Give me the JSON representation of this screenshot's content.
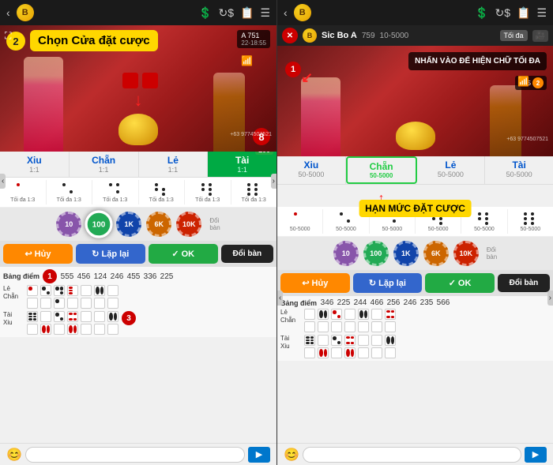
{
  "left_panel": {
    "nav": {
      "back_icon": "‹",
      "coin_label": "B",
      "dollar_icon": "$",
      "refresh_icon": "↻",
      "list_icon": "≡",
      "menu_icon": "☰"
    },
    "annotation": {
      "step2_label": "2",
      "instruction": "Chọn Cửa đặt cược",
      "step8_label": "8",
      "step1_label": "1",
      "step3_label": "3"
    },
    "bet_columns": [
      {
        "label": "Xiu",
        "ratio": "1:1",
        "active": false
      },
      {
        "label": "Chẵn",
        "ratio": "1:1",
        "active": false
      },
      {
        "label": "Lẻ",
        "ratio": "1:1",
        "active": false
      },
      {
        "label": "Tài",
        "ratio": "1:1",
        "active": true,
        "value": "100"
      }
    ],
    "chips": [
      {
        "value": "10",
        "color": "#8855aa"
      },
      {
        "value": "100",
        "color": "#22aa55",
        "selected": true
      },
      {
        "value": "1K",
        "color": "#1144aa"
      },
      {
        "value": "6K",
        "color": "#cc6600"
      },
      {
        "value": "10K",
        "color": "#cc2200"
      }
    ],
    "buttons": {
      "cancel": "Hủy",
      "replay": "Lặp lại",
      "ok": "OK",
      "change_table": "Đổi bàn"
    },
    "score_board": {
      "label": "Bảng điểm",
      "numbers": [
        "555",
        "456",
        "124",
        "246",
        "455",
        "336",
        "225"
      ],
      "rows": [
        {
          "label": "Lẻ\nChẵn"
        },
        {
          "label": "Tài\nXiu"
        }
      ]
    }
  },
  "right_panel": {
    "nav": {
      "back_icon": "‹",
      "coin_label": "B",
      "dollar_icon": "$",
      "refresh_icon": "↻",
      "list_icon": "≡",
      "menu_icon": "☰"
    },
    "game_info": {
      "close": "✕",
      "name": "Sic Bo A",
      "id": "759",
      "range": "10-5000",
      "toi_da": "Tối đa",
      "cam": "🎥"
    },
    "annotation": {
      "step1_label": "1",
      "note_title": "NHẤN VÀO ĐỂ HIỆN\nCHỮ TỐI ĐA",
      "han_muc": "HẠN MỨC ĐẶT CƯỢC"
    },
    "bet_columns": [
      {
        "label": "Xiu",
        "ratio": "50-5000",
        "active": false
      },
      {
        "label": "Chẵn",
        "ratio": "50-5000",
        "highlighted": true
      },
      {
        "label": "Lẻ",
        "ratio": "50-5000",
        "active": false
      },
      {
        "label": "Tài",
        "ratio": "50-5000",
        "active": false
      }
    ],
    "chips": [
      {
        "value": "10",
        "color": "#8855aa"
      },
      {
        "value": "100",
        "color": "#22aa55"
      },
      {
        "value": "1K",
        "color": "#1144aa"
      },
      {
        "value": "6K",
        "color": "#cc6600"
      },
      {
        "value": "10K",
        "color": "#cc2200"
      }
    ],
    "buttons": {
      "cancel": "Hủy",
      "replay": "Lặp lại",
      "ok": "OK",
      "change_table": "Đổi bàn"
    },
    "score_board": {
      "label": "Bảng điểm",
      "numbers": [
        "346",
        "225",
        "244",
        "466",
        "256",
        "246",
        "235",
        "566"
      ],
      "rows": [
        {
          "label": "Lẻ\nChẵn"
        },
        {
          "label": "Tài\nXiu"
        }
      ]
    }
  }
}
